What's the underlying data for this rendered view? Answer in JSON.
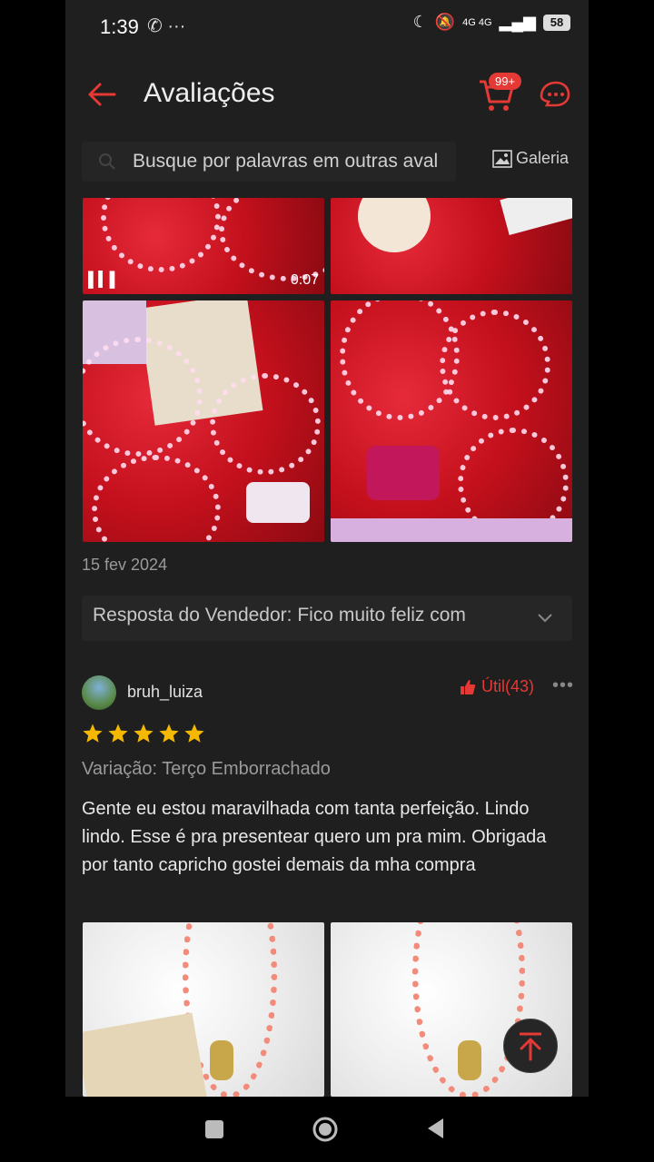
{
  "status_bar": {
    "time": "1:39",
    "left_icons": "✆ ···",
    "network": "4G 4G",
    "battery": "58"
  },
  "header": {
    "title": "Avaliações",
    "cart_badge": "99+"
  },
  "search": {
    "placeholder": "Busque por palavras em outras aval",
    "gallery_label": "Galeria"
  },
  "review1": {
    "video_duration": "0:07",
    "date": "15 fev 2024",
    "seller_reply": "Resposta do Vendedor: Fico muito feliz com"
  },
  "review2": {
    "username": "bruh_luiza",
    "useful_label": "Útil(43)",
    "more_label": "•••",
    "rating": 5,
    "variation": "Variação: Terço Emborrachado",
    "text": "Gente eu estou maravilhada com tanta perfeição. Lindo lindo. Esse é pra presentear quero um pra mim. Obrigada por tanto capricho gostei demais da mha compra"
  },
  "colors": {
    "accent": "#e53935",
    "star": "#f5b800",
    "background": "#1f1f1f"
  },
  "icons": [
    "back-arrow-icon",
    "cart-icon",
    "chat-icon",
    "search-icon",
    "image-icon",
    "chevron-down-icon",
    "thumbs-up-icon",
    "star-icon",
    "arrow-up-icon"
  ]
}
